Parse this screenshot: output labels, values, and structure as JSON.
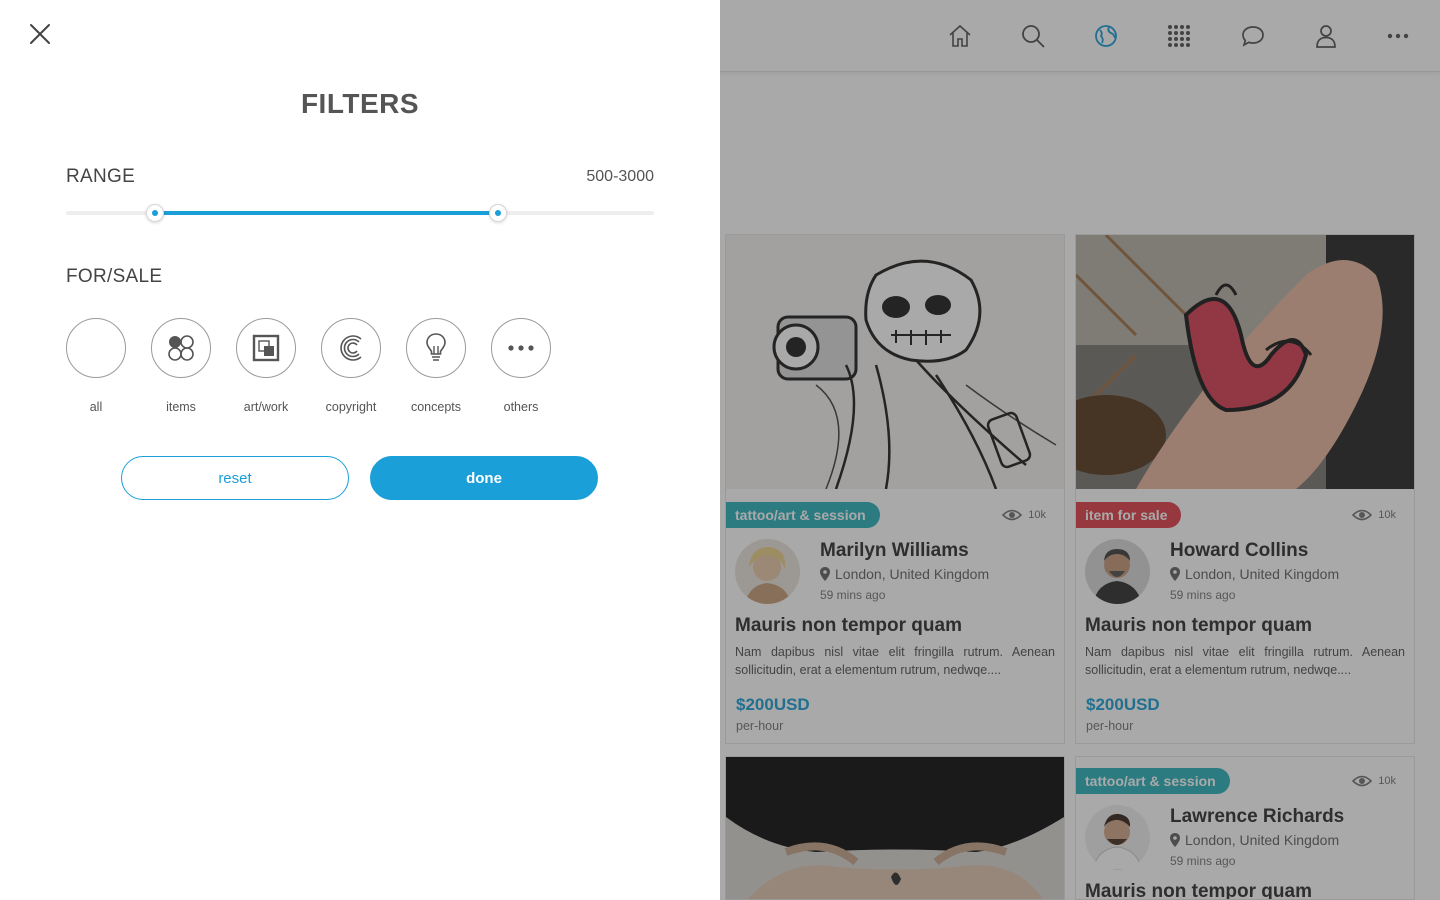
{
  "panel": {
    "title": "FILTERS",
    "range": {
      "label": "RANGE",
      "value_text": "500-3000",
      "min_fraction": 0.152,
      "max_fraction": 0.735
    },
    "for_sale": {
      "label": "FOR/SALE"
    },
    "categories": [
      {
        "label": "all",
        "icon": "for-all-icon",
        "active": true
      },
      {
        "label": "items",
        "icon": "items-icon",
        "active": false
      },
      {
        "label": "art/work",
        "icon": "artwork-icon",
        "active": false
      },
      {
        "label": "copyright",
        "icon": "copyright-icon",
        "active": false
      },
      {
        "label": "concepts",
        "icon": "lightbulb-icon",
        "active": false
      },
      {
        "label": "others",
        "icon": "more-dots-icon",
        "active": false
      }
    ],
    "buttons": {
      "reset": "reset",
      "done": "done"
    },
    "accent_color": "#1b9fd9"
  },
  "topnav": {
    "icons": [
      "home-icon",
      "search-icon",
      "globe-icon",
      "grid-icon",
      "chat-icon",
      "user-icon",
      "more-icon"
    ],
    "active": "globe-icon"
  },
  "cards": [
    {
      "tag": "tattoo/art & session",
      "tag_color": "#2fb3bd",
      "views": "10k",
      "user": "Marilyn Williams",
      "location": "London, United Kingdom",
      "time": "59 mins ago",
      "title": "Mauris non tempor quam",
      "description": "Nam dapibus nisl vitae elit fringilla rutrum. Aenean sollicitudin, erat a elementum rutrum, nedwqe....",
      "price": "$200USD",
      "price_unit": "per-hour"
    },
    {
      "tag": "item for sale",
      "tag_color": "#e0444e",
      "views": "10k",
      "user": "Howard Collins",
      "location": "London, United Kingdom",
      "time": "59 mins ago",
      "title": "Mauris non tempor quam",
      "description": "Nam dapibus nisl vitae elit fringilla rutrum. Aenean sollicitudin, erat a elementum rutrum, nedwqe....",
      "price": "$200USD",
      "price_unit": "per-hour"
    },
    {
      "tag": "tattoo/art & session",
      "tag_color": "#2fb3bd",
      "views": "10k",
      "user": "Lawrence Richards",
      "location": "London, United Kingdom",
      "time": "59 mins ago",
      "title": "Mauris non tempor quam"
    }
  ]
}
